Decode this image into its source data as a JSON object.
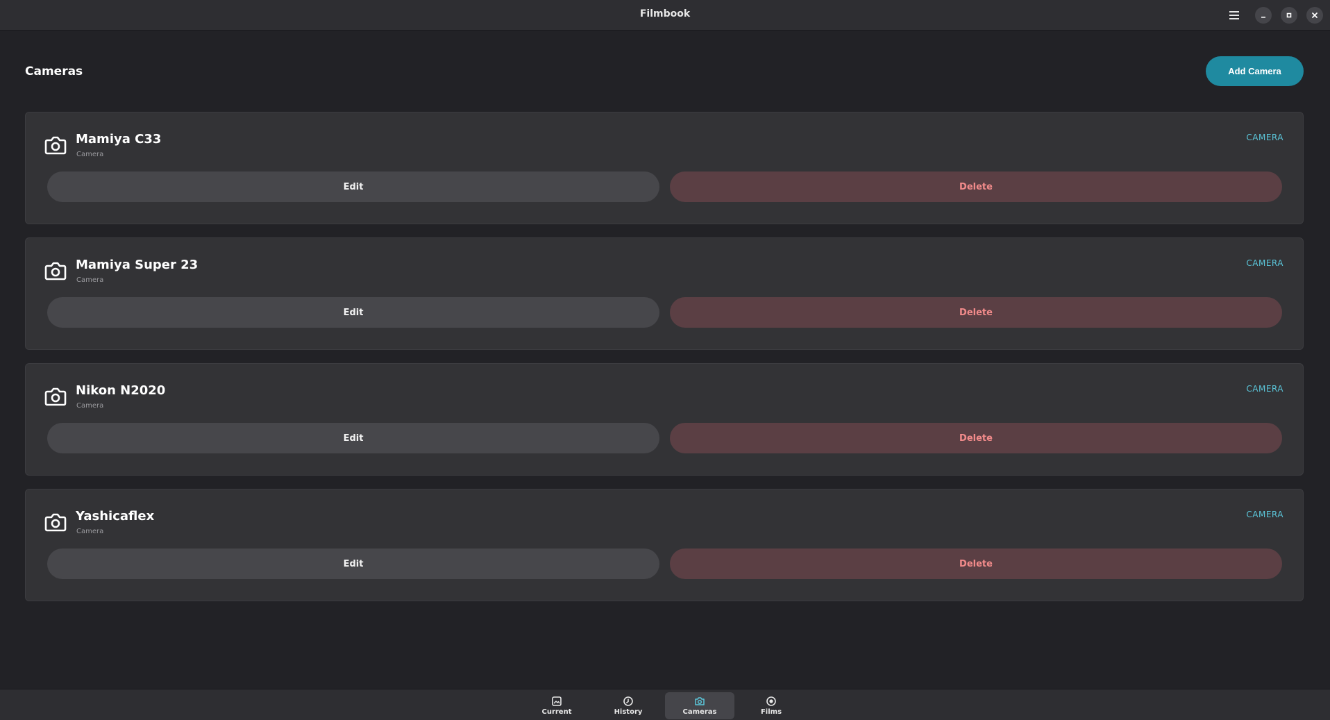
{
  "window": {
    "title": "Filmbook"
  },
  "page": {
    "title": "Cameras",
    "add_button_label": "Add Camera"
  },
  "cameras": [
    {
      "name": "Mamiya C33",
      "subtitle": "Camera",
      "tag": "CAMERA",
      "edit_label": "Edit",
      "delete_label": "Delete"
    },
    {
      "name": "Mamiya Super 23",
      "subtitle": "Camera",
      "tag": "CAMERA",
      "edit_label": "Edit",
      "delete_label": "Delete"
    },
    {
      "name": "Nikon N2020",
      "subtitle": "Camera",
      "tag": "CAMERA",
      "edit_label": "Edit",
      "delete_label": "Delete"
    },
    {
      "name": "Yashicaflex",
      "subtitle": "Camera",
      "tag": "CAMERA",
      "edit_label": "Edit",
      "delete_label": "Delete"
    }
  ],
  "nav": {
    "tabs": [
      {
        "label": "Current",
        "icon": "image-icon",
        "active": false
      },
      {
        "label": "History",
        "icon": "clock-icon",
        "active": false
      },
      {
        "label": "Cameras",
        "icon": "camera-icon",
        "active": true
      },
      {
        "label": "Films",
        "icon": "film-reel-icon",
        "active": false
      }
    ]
  },
  "colors": {
    "accent": "#1f8aa0",
    "tag": "#5bc6da",
    "delete_text": "#f28b8b",
    "delete_bg": "#5b3f44"
  }
}
